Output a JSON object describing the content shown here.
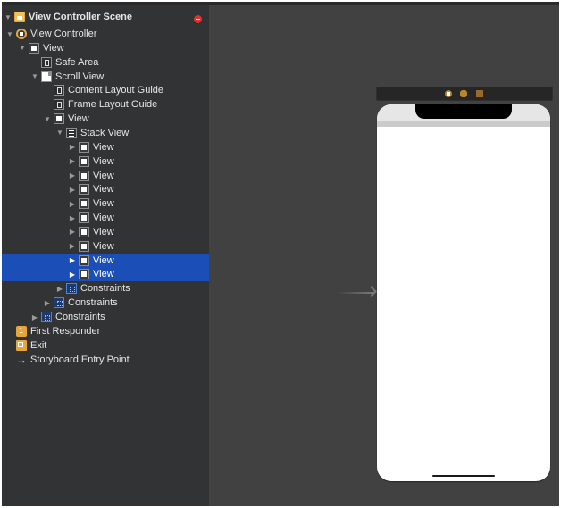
{
  "outline": {
    "scene_title": "View Controller Scene",
    "rows": [
      {
        "label": "View Controller",
        "icon": "view-controller-icon",
        "disclosure": "expanded",
        "depth": 1
      },
      {
        "label": "View",
        "icon": "view-icon",
        "disclosure": "expanded",
        "depth": 2
      },
      {
        "label": "Safe Area",
        "icon": "layout-guide-icon",
        "disclosure": "none",
        "depth": 3
      },
      {
        "label": "Scroll View",
        "icon": "scroll-view-icon",
        "disclosure": "expanded",
        "depth": 3
      },
      {
        "label": "Content Layout Guide",
        "icon": "layout-guide-icon",
        "disclosure": "none",
        "depth": 4
      },
      {
        "label": "Frame Layout Guide",
        "icon": "layout-guide-icon",
        "disclosure": "none",
        "depth": 4
      },
      {
        "label": "View",
        "icon": "view-icon",
        "disclosure": "expanded",
        "depth": 4
      },
      {
        "label": "Stack View",
        "icon": "stack-view-icon",
        "disclosure": "expanded",
        "depth": 5
      },
      {
        "label": "View",
        "icon": "view-icon",
        "disclosure": "collapsed",
        "depth": 6
      },
      {
        "label": "View",
        "icon": "view-icon",
        "disclosure": "collapsed",
        "depth": 6
      },
      {
        "label": "View",
        "icon": "view-icon",
        "disclosure": "collapsed",
        "depth": 6
      },
      {
        "label": "View",
        "icon": "view-icon",
        "disclosure": "collapsed",
        "depth": 6
      },
      {
        "label": "View",
        "icon": "view-icon",
        "disclosure": "collapsed",
        "depth": 6
      },
      {
        "label": "View",
        "icon": "view-icon",
        "disclosure": "collapsed",
        "depth": 6
      },
      {
        "label": "View",
        "icon": "view-icon",
        "disclosure": "collapsed",
        "depth": 6
      },
      {
        "label": "View",
        "icon": "view-icon",
        "disclosure": "collapsed",
        "depth": 6
      },
      {
        "label": "View",
        "icon": "view-icon",
        "disclosure": "collapsed",
        "depth": 6,
        "selected": true
      },
      {
        "label": "View",
        "icon": "view-icon",
        "disclosure": "collapsed",
        "depth": 6,
        "selected": true
      },
      {
        "label": "Constraints",
        "icon": "constraints-icon",
        "disclosure": "collapsed",
        "depth": 5
      },
      {
        "label": "Constraints",
        "icon": "constraints-icon",
        "disclosure": "collapsed",
        "depth": 4
      },
      {
        "label": "Constraints",
        "icon": "constraints-icon",
        "disclosure": "collapsed",
        "depth": 3
      },
      {
        "label": "First Responder",
        "icon": "first-responder-icon",
        "disclosure": "none",
        "depth": 1
      },
      {
        "label": "Exit",
        "icon": "exit-icon",
        "disclosure": "none",
        "depth": 1
      },
      {
        "label": "Storyboard Entry Point",
        "icon": "entry-point-arrow-icon",
        "disclosure": "none",
        "depth": 1
      }
    ]
  },
  "canvas": {
    "scene_dock_icons": [
      "view-controller-icon",
      "first-responder-icon",
      "exit-icon"
    ]
  },
  "colors": {
    "selection": "#1b4eb6",
    "outline_bg": "#323335",
    "canvas_bg": "#414141",
    "accent_orange": "#e8a53a",
    "warning_red": "#e0332b"
  }
}
